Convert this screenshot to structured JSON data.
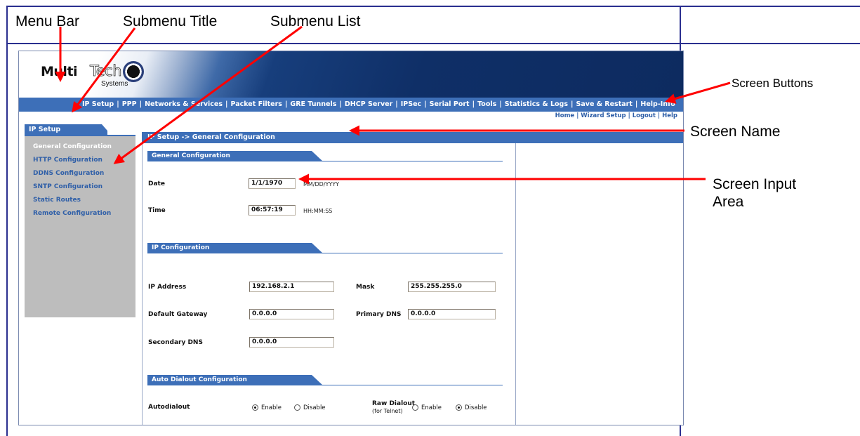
{
  "callouts": {
    "menu_bar": "Menu Bar",
    "submenu_title": "Submenu Title",
    "submenu_list": "Submenu List",
    "screen_buttons": "Screen Buttons",
    "screen_name": "Screen Name",
    "screen_input_area_line1": "Screen Input",
    "screen_input_area_line2": "Area"
  },
  "logo": {
    "multi": "Multi",
    "tech": "Tech",
    "systems": "Systems"
  },
  "menu": {
    "items": [
      "IP Setup",
      "PPP",
      "Networks & Services",
      "Packet Filters",
      "GRE Tunnels",
      "DHCP Server",
      "IPSec",
      "Serial Port",
      "Tools",
      "Statistics & Logs",
      "Save & Restart",
      "Help-Info"
    ],
    "separator": "|"
  },
  "screen_buttons": [
    "Home",
    "Wizard Setup",
    "Logout",
    "Help"
  ],
  "sidebar": {
    "title": "IP Setup",
    "items": [
      "General Configuration",
      "HTTP Configuration",
      "DDNS Configuration",
      "SNTP Configuration",
      "Static Routes",
      "Remote Configuration"
    ],
    "active_index": 0
  },
  "screen_name": "IP Setup -> General Configuration",
  "general": {
    "title": "General Configuration",
    "date_label": "Date",
    "date_value": "1/1/1970",
    "date_hint": "MM/DD/YYYY",
    "time_label": "Time",
    "time_value": "06:57:19",
    "time_hint": "HH:MM:SS"
  },
  "ip": {
    "title": "IP Configuration",
    "ip_address_label": "IP Address",
    "ip_address_value": "192.168.2.1",
    "mask_label": "Mask",
    "mask_value": "255.255.255.0",
    "gateway_label": "Default Gateway",
    "gateway_value": "0.0.0.0",
    "primary_dns_label": "Primary DNS",
    "primary_dns_value": "0.0.0.0",
    "secondary_dns_label": "Secondary DNS",
    "secondary_dns_value": "0.0.0.0"
  },
  "autodial": {
    "title": "Auto Dialout Configuration",
    "autodialout_label": "Autodialout",
    "enable": "Enable",
    "disable": "Disable",
    "autodialout_selected": "Enable",
    "raw_label": "Raw Dialout",
    "raw_sublabel": "(for Telnet)",
    "raw_selected": "Disable"
  },
  "colors": {
    "menu_blue": "#3d6fb8",
    "banner_navy": "#0f2f67",
    "link_blue": "#2f5fa8",
    "sidebar_gray": "#bdbdbd",
    "arrow_red": "#ff0000",
    "border_navy": "#2a2f8f"
  }
}
